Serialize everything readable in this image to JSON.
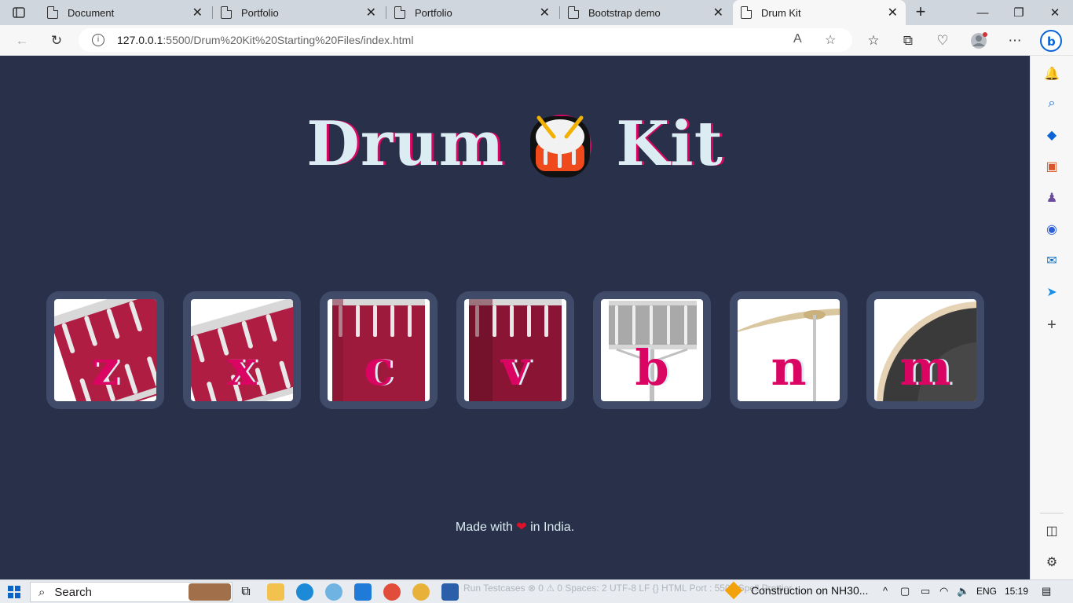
{
  "browser": {
    "tabs": [
      {
        "label": "Document",
        "active": false
      },
      {
        "label": "Portfolio",
        "active": false
      },
      {
        "label": "Portfolio",
        "active": false
      },
      {
        "label": "Bootstrap demo",
        "active": false
      },
      {
        "label": "Drum Kit",
        "active": true
      }
    ],
    "url_host": "127.0.0.1",
    "url_path": ":5500/Drum%20Kit%20Starting%20Files/index.html"
  },
  "page": {
    "title_left": "Drum",
    "title_right": "Kit",
    "drums": [
      {
        "key": "z"
      },
      {
        "key": "x"
      },
      {
        "key": "c"
      },
      {
        "key": "v"
      },
      {
        "key": "b"
      },
      {
        "key": "n"
      },
      {
        "key": "m"
      }
    ],
    "footer_before": "Made with",
    "footer_heart": "❤",
    "footer_after": "in India."
  },
  "taskbar": {
    "search_label": "Search",
    "news": "Construction on NH30...",
    "language": "ENG",
    "time": "15:19",
    "ghost_text": "Run Testcases   ⊗ 0 ⚠ 0      Spaces: 2   UTF-8   LF   {} HTML   Port : 5500   Spell   Prettier"
  },
  "colors": {
    "page_bg": "#283149",
    "drum_bg": "#404b69",
    "accent": "#da0463",
    "text": "#dbedf3"
  }
}
